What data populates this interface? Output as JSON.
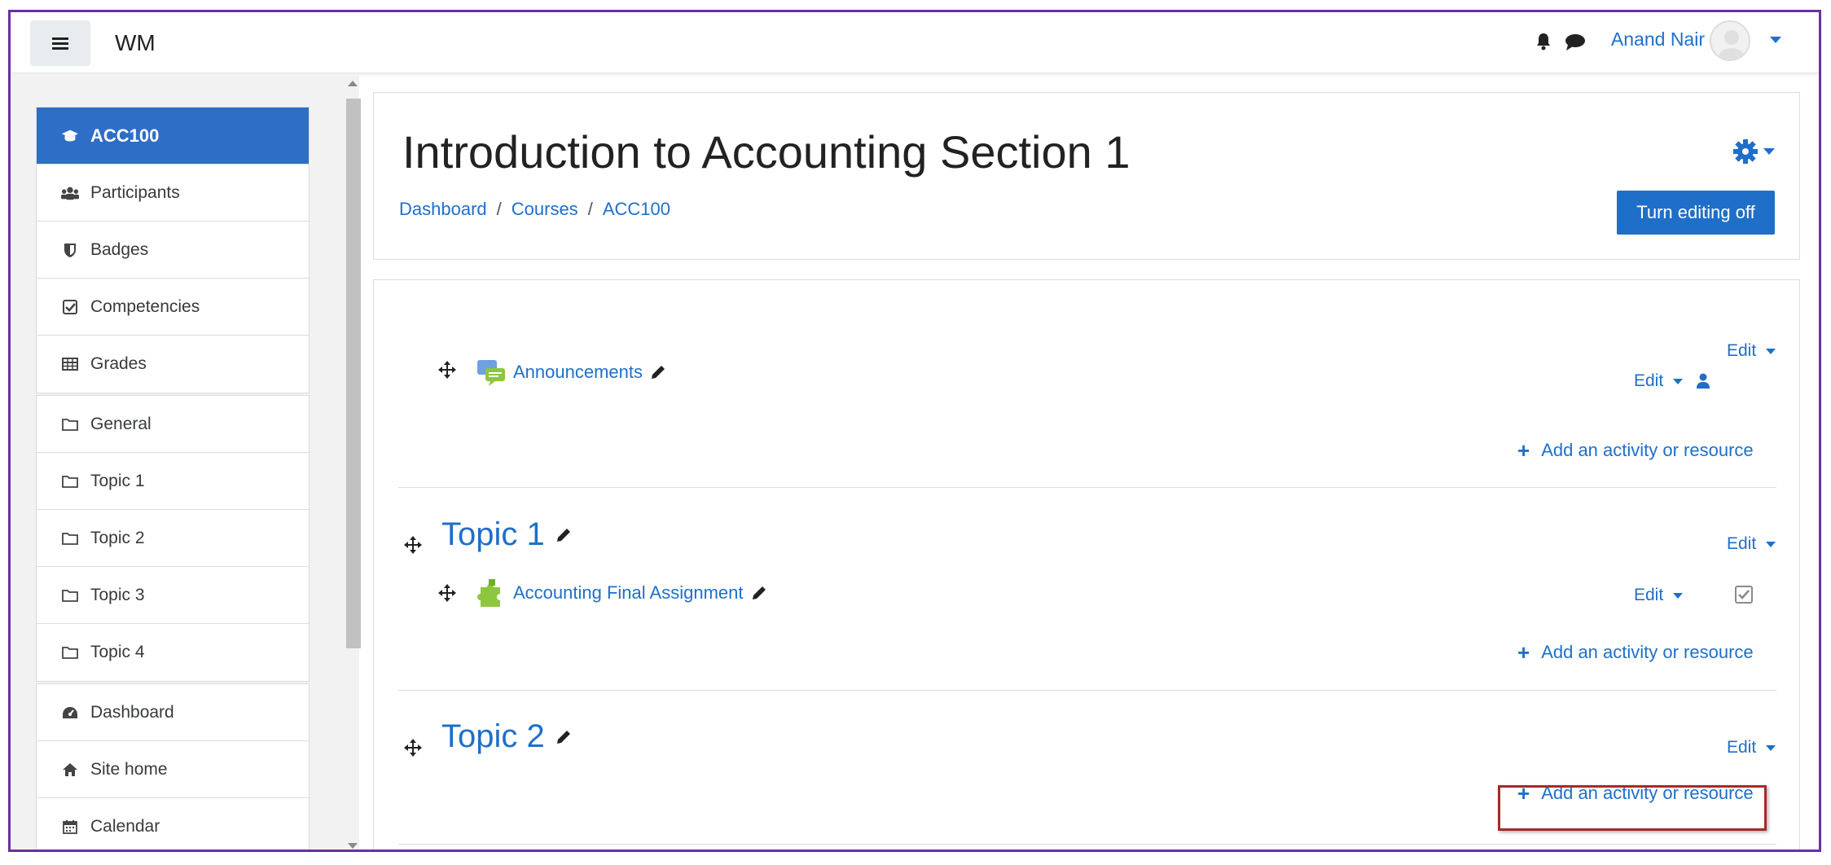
{
  "navbar": {
    "brand": "WM",
    "user_name": "Anand Nair"
  },
  "drawer": {
    "course_group": [
      {
        "label": "ACC100",
        "icon": "graduation-cap-icon",
        "active": true
      },
      {
        "label": "Participants",
        "icon": "users-icon"
      },
      {
        "label": "Badges",
        "icon": "shield-icon"
      },
      {
        "label": "Competencies",
        "icon": "check-square-icon"
      },
      {
        "label": "Grades",
        "icon": "table-icon"
      }
    ],
    "sections_group": [
      {
        "label": "General",
        "icon": "folder-icon"
      },
      {
        "label": "Topic 1",
        "icon": "folder-icon"
      },
      {
        "label": "Topic 2",
        "icon": "folder-icon"
      },
      {
        "label": "Topic 3",
        "icon": "folder-icon"
      },
      {
        "label": "Topic 4",
        "icon": "folder-icon"
      }
    ],
    "site_group": [
      {
        "label": "Dashboard",
        "icon": "tachometer-icon"
      },
      {
        "label": "Site home",
        "icon": "home-icon"
      },
      {
        "label": "Calendar",
        "icon": "calendar-icon"
      }
    ]
  },
  "header": {
    "title": "Introduction to Accounting Section 1",
    "breadcrumb": [
      "Dashboard",
      "Courses",
      "ACC100"
    ],
    "breadcrumb_sep": "/",
    "editing_button": "Turn editing off"
  },
  "content": {
    "edit_label": "Edit",
    "add_label": "Add an activity or resource",
    "general": {
      "activity": "Announcements"
    },
    "topic1": {
      "title": "Topic 1",
      "activity": "Accounting Final Assignment"
    },
    "topic2": {
      "title": "Topic 2"
    }
  },
  "colors": {
    "accent": "#1f6fc9",
    "active_nav": "#2f6ec6",
    "highlight_box": "#a52a2a",
    "frame": "#6a2fa0"
  }
}
